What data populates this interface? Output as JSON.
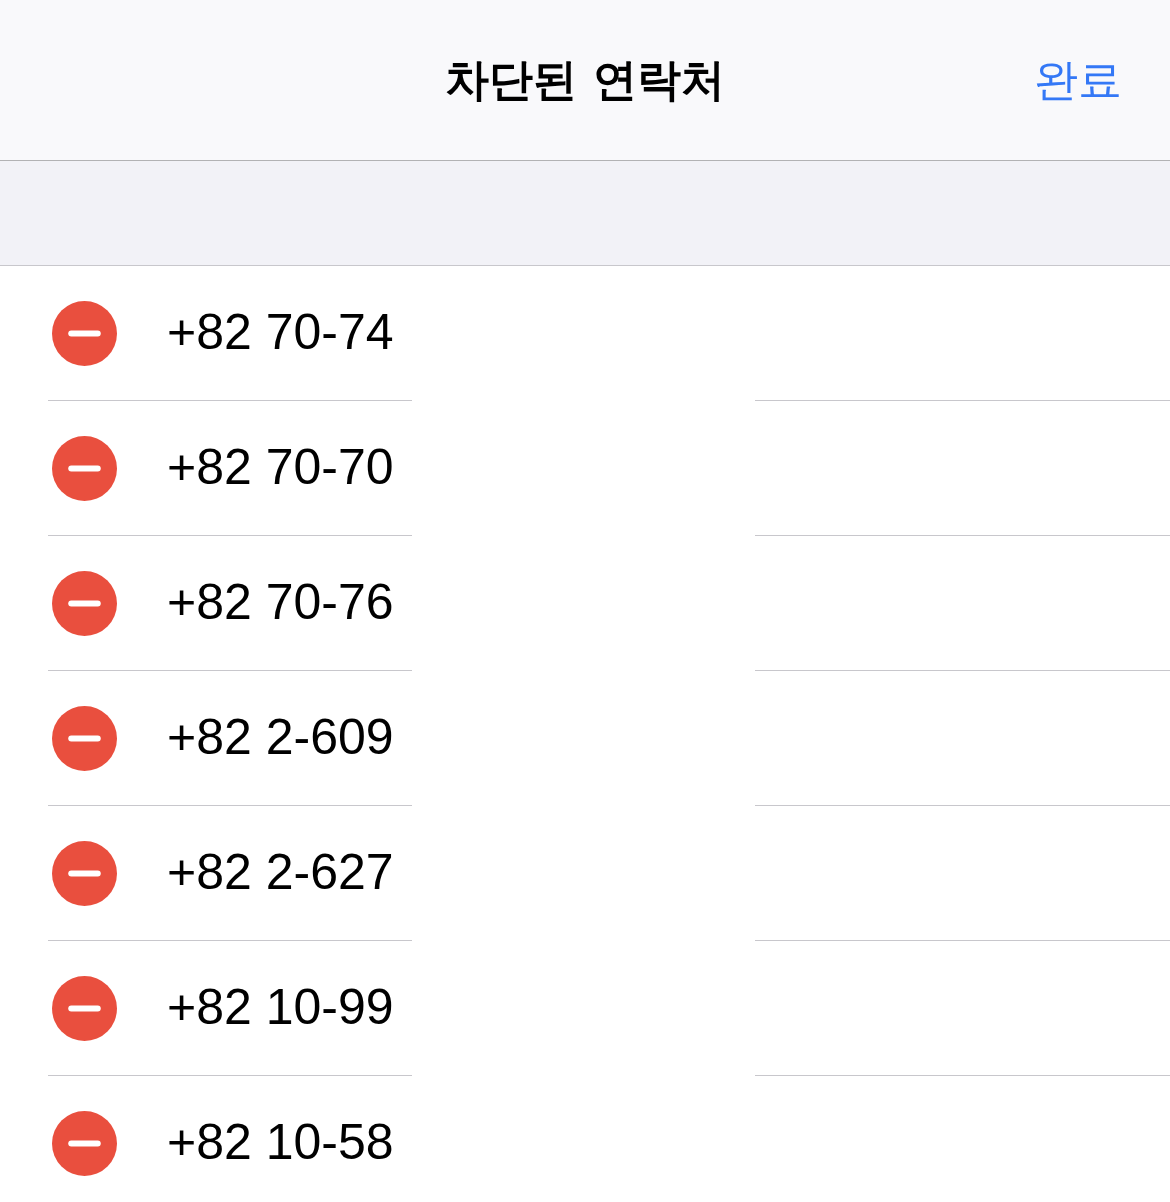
{
  "nav_bar": {
    "title": "차단된 연락처",
    "done_button": "완료"
  },
  "blocked_contacts": [
    {
      "number": "+82 70-74"
    },
    {
      "number": "+82 70-70"
    },
    {
      "number": "+82 70-76"
    },
    {
      "number": "+82 2-609"
    },
    {
      "number": "+82 2-627"
    },
    {
      "number": "+82 10-99"
    },
    {
      "number": "+82 10-58"
    }
  ]
}
